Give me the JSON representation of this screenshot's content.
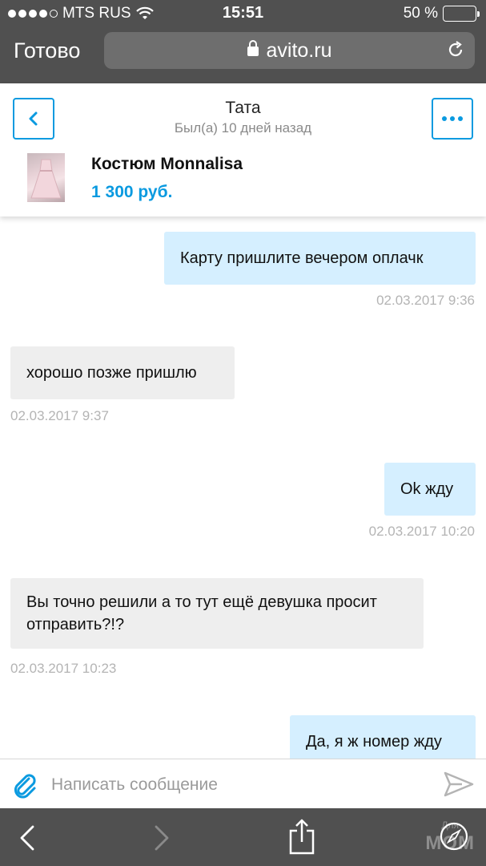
{
  "status_bar": {
    "carrier": "MTS RUS",
    "time": "15:51",
    "battery": "50 %",
    "battery_level": 0.5,
    "icons": [
      "signal-dots-icon",
      "wifi-icon",
      "battery-icon"
    ]
  },
  "browser": {
    "done_label": "Готово",
    "url": "avito.ru",
    "icons": [
      "lock-icon",
      "reload-icon"
    ]
  },
  "chat_header": {
    "contact_name": "Тата",
    "contact_status": "Был(а) 10 дней назад",
    "icons": [
      "chevron-left-icon",
      "more-dots-icon"
    ]
  },
  "product": {
    "title": "Костюм Monnalisa",
    "price": "1 300 руб."
  },
  "messages": [
    {
      "direction": "out",
      "text": "Карту  пришлите вечером оплачк",
      "timestamp": "02.03.2017 9:36"
    },
    {
      "direction": "in",
      "text": "хорошо позже пришлю",
      "timestamp": "02.03.2017 9:37"
    },
    {
      "direction": "out",
      "text": "Ok жду",
      "timestamp": "02.03.2017 10:20"
    },
    {
      "direction": "in",
      "text": "Вы точно решили а то тут ещё девушка просит отправить?!?",
      "timestamp": "02.03.2017 10:23"
    },
    {
      "direction": "out",
      "text": "Да, я ж номер жду",
      "timestamp": ""
    }
  ],
  "composer": {
    "placeholder": "Написать сообщение",
    "value": "",
    "icons": [
      "paperclip-icon",
      "send-icon"
    ]
  },
  "toolbar": {
    "icons": [
      "back-arrow-icon",
      "forward-arrow-icon",
      "share-icon",
      "compass-icon"
    ],
    "watermark": "МОМ",
    "watermark_small": "Для"
  },
  "colors": {
    "accent": "#0a9ae0",
    "outgoing_bubble": "#d5efff",
    "incoming_bubble": "#eeeeee",
    "chrome": "#505050",
    "battery": "#f6c200"
  }
}
